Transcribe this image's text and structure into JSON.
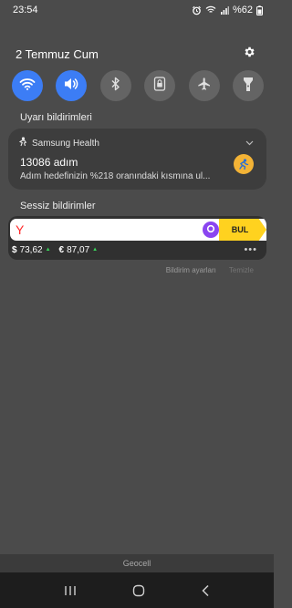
{
  "status_bar": {
    "time": "23:54",
    "battery": "%62",
    "icons": [
      "alarm-icon",
      "wifi-icon",
      "signal-icon",
      "battery-icon"
    ]
  },
  "header": {
    "date": "2 Temmuz Cum",
    "settings_icon": "gear-icon"
  },
  "quick_settings": [
    {
      "name": "wifi",
      "icon": "wifi-icon",
      "active": true
    },
    {
      "name": "sound",
      "icon": "speaker-icon",
      "active": true
    },
    {
      "name": "bluetooth",
      "icon": "bluetooth-icon",
      "active": false
    },
    {
      "name": "rotation-lock",
      "icon": "lock-icon",
      "active": false
    },
    {
      "name": "airplane",
      "icon": "airplane-icon",
      "active": false
    },
    {
      "name": "flashlight",
      "icon": "flashlight-icon",
      "active": false
    }
  ],
  "alerts": {
    "section_title": "Uyarı bildirimleri",
    "notification": {
      "app_name": "Samsung Health",
      "title": "13086 adım",
      "body": "Adım hedefinizin %218 oranındaki kısmına ul..."
    }
  },
  "silent": {
    "section_title": "Sessiz bildirimler",
    "yandex": {
      "logo": "Y",
      "find_label": "BUL",
      "rates": [
        {
          "symbol": "$",
          "value": "73,62"
        },
        {
          "symbol": "€",
          "value": "87,07"
        }
      ],
      "more": "•••"
    }
  },
  "actions": {
    "settings": "Bildirim ayarları",
    "clear": "Temizle"
  },
  "carrier": "Geocell",
  "colors": {
    "background": "#4b4b4b",
    "active_toggle": "#3c7df5",
    "inactive_toggle": "#646464",
    "find_button": "#ffd21f",
    "yandex_red": "#ff2b2b",
    "alice_purple": "#8a45f0",
    "up_green": "#3ad65b"
  }
}
